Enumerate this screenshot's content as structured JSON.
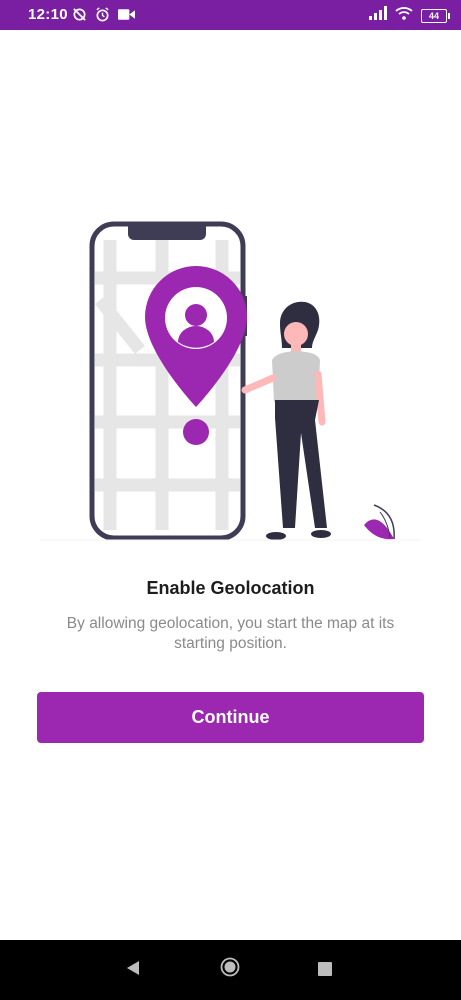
{
  "status_bar": {
    "time": "12:10",
    "battery_level": "44",
    "left_icons": [
      "no-sync-icon",
      "alarm-icon",
      "video-camera-icon"
    ],
    "right_icons": [
      "signal-icon",
      "wifi-icon",
      "battery-icon"
    ],
    "background_color": "#7b1fa2"
  },
  "illustration": {
    "description_icons": [
      "phone-map-icon",
      "location-pin-icon",
      "person-icon",
      "plant-icon"
    ],
    "accent_color": "#9c27b0"
  },
  "content": {
    "title": "Enable Geolocation",
    "subtitle": "By allowing geolocation, you start the map at its starting position."
  },
  "actions": {
    "continue_label": "Continue",
    "button_color": "#9c27b0"
  },
  "nav_bar": {
    "icons": [
      "back-icon",
      "home-icon",
      "recents-icon"
    ]
  }
}
